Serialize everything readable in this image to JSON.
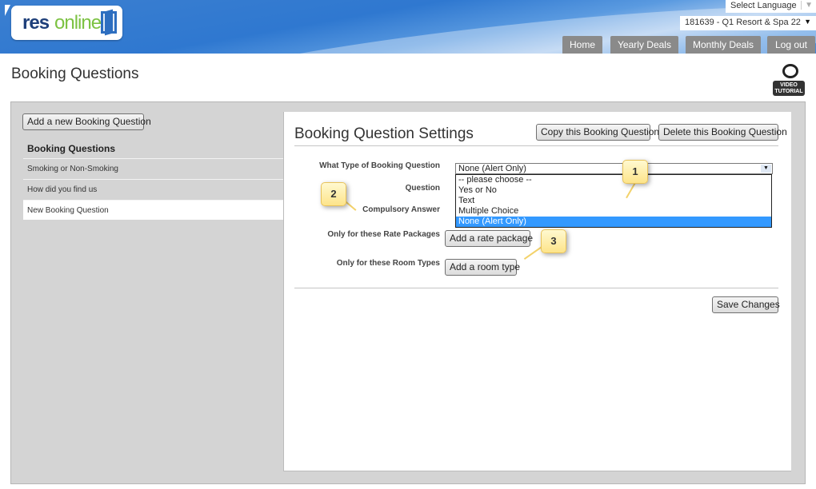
{
  "header": {
    "logo_res": "res",
    "logo_online": "online",
    "language_select": "Select Language",
    "hotel_select": "181639 - Q1 Resort & Spa 22",
    "nav": [
      "Home",
      "Yearly Deals",
      "Monthly Deals",
      "Log out"
    ]
  },
  "page": {
    "title": "Booking Questions",
    "video_label_1": "VIDEO",
    "video_label_2": "TUTORIAL"
  },
  "sidebar": {
    "add_button": "Add a new Booking Question",
    "title": "Booking Questions",
    "items": [
      {
        "label": "Smoking or Non-Smoking",
        "active": false
      },
      {
        "label": "How did you find us",
        "active": false
      },
      {
        "label": "New Booking Question",
        "active": true
      }
    ]
  },
  "settings": {
    "title": "Booking Question Settings",
    "copy_button": "Copy this Booking Question",
    "delete_button": "Delete this Booking Question",
    "type_label": "What Type of Booking Question",
    "type_value": "None (Alert Only)",
    "type_options": [
      "-- please choose --",
      "Yes or No",
      "Text",
      "Multiple Choice",
      "None (Alert Only)"
    ],
    "question_label": "Question",
    "compulsory_label": "Compulsory Answer",
    "rate_label": "Only for these Rate Packages",
    "rate_button": "Add a rate package",
    "room_label": "Only for these Room Types",
    "room_button": "Add a room type",
    "save_button": "Save Changes"
  },
  "callouts": [
    "1",
    "2",
    "3"
  ]
}
